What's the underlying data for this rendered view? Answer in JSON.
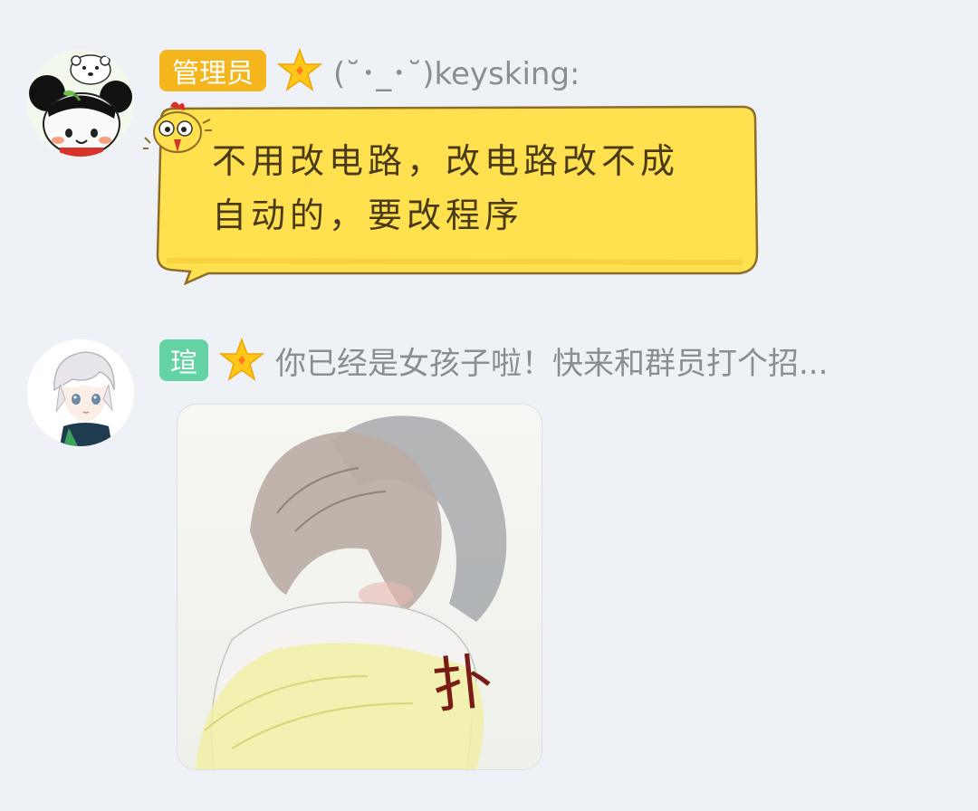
{
  "messages": [
    {
      "role_badge": "管理员",
      "role_color": "#f4b61c",
      "nickname": "(˘･_･˘)keysking:",
      "text_line1": "不用改电路，改电路改不成",
      "text_line2": "自动的，要改程序",
      "bubble_color": "#ffe14f",
      "avatar_icon": "bear-avatar-icon"
    },
    {
      "role_badge": "瑄",
      "role_color": "#63d3a3",
      "nickname": "你已经是女孩子啦！快来和群员打个招...",
      "image_caption": "扑",
      "avatar_icon": "white-hair-boy-avatar-icon"
    }
  ]
}
